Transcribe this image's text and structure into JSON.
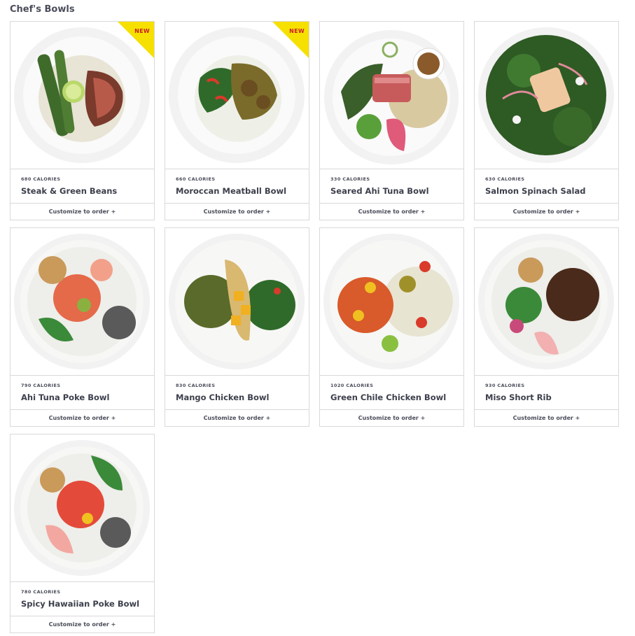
{
  "section": {
    "title": "Chef's Bowls"
  },
  "colors": {
    "badge": "#f6e000",
    "badge_text": "#c8202a",
    "border": "#d9d9dc"
  },
  "cards": [
    {
      "calories": "680 CALORIES",
      "name": "Steak & Green Beans",
      "cta": "Customize to order +",
      "badge": "NEW",
      "icon": "steak-bowl-image"
    },
    {
      "calories": "660 CALORIES",
      "name": "Moroccan Meatball Bowl",
      "cta": "Customize to order +",
      "badge": "NEW",
      "icon": "meatball-bowl-image"
    },
    {
      "calories": "330 CALORIES",
      "name": "Seared Ahi Tuna Bowl",
      "cta": "Customize to order +",
      "badge": "",
      "icon": "ahi-tuna-bowl-image"
    },
    {
      "calories": "630 CALORIES",
      "name": "Salmon Spinach Salad",
      "cta": "Customize to order +",
      "badge": "",
      "icon": "salmon-salad-image"
    },
    {
      "calories": "790 CALORIES",
      "name": "Ahi Tuna Poke Bowl",
      "cta": "Customize to order +",
      "badge": "",
      "icon": "poke-bowl-image"
    },
    {
      "calories": "830 CALORIES",
      "name": "Mango Chicken Bowl",
      "cta": "Customize to order +",
      "badge": "",
      "icon": "mango-chicken-bowl-image"
    },
    {
      "calories": "1020 CALORIES",
      "name": "Green Chile Chicken Bowl",
      "cta": "Customize to order +",
      "badge": "",
      "icon": "green-chile-bowl-image"
    },
    {
      "calories": "930 CALORIES",
      "name": "Miso Short Rib",
      "cta": "Customize to order +",
      "badge": "",
      "icon": "short-rib-bowl-image"
    },
    {
      "calories": "780 CALORIES",
      "name": "Spicy Hawaiian Poke Bowl",
      "cta": "Customize to order +",
      "badge": "",
      "icon": "hawaiian-poke-bowl-image"
    }
  ]
}
